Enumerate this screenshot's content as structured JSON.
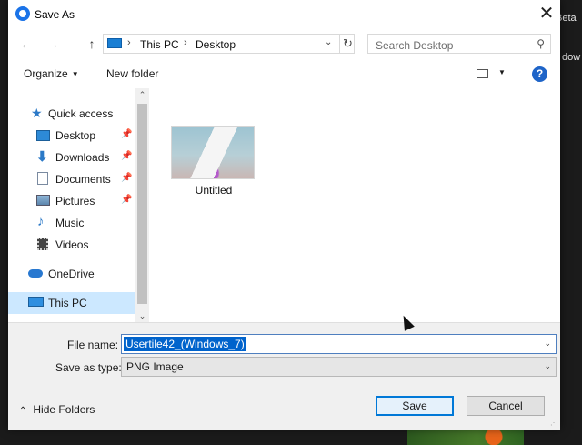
{
  "background": {
    "top_right_text": "Beta",
    "right_text": "dow"
  },
  "window": {
    "title": "Save As"
  },
  "address_bar": {
    "crumbs": [
      "This PC",
      "Desktop"
    ]
  },
  "search": {
    "placeholder": "Search Desktop"
  },
  "toolbar": {
    "organize_label": "Organize",
    "new_folder_label": "New folder"
  },
  "sidebar": {
    "items": [
      {
        "label": "Quick access",
        "icon": "star-icon",
        "pinned": false
      },
      {
        "label": "Desktop",
        "icon": "desktop-folder-icon",
        "pinned": true
      },
      {
        "label": "Downloads",
        "icon": "download-arrow-icon",
        "pinned": true
      },
      {
        "label": "Documents",
        "icon": "documents-icon",
        "pinned": true
      },
      {
        "label": "Pictures",
        "icon": "pictures-icon",
        "pinned": true
      },
      {
        "label": "Music",
        "icon": "music-note-icon",
        "pinned": false
      },
      {
        "label": "Videos",
        "icon": "film-strip-icon",
        "pinned": false
      },
      {
        "label": "OneDrive",
        "icon": "cloud-icon",
        "pinned": false
      },
      {
        "label": "This PC",
        "icon": "computer-icon",
        "pinned": false,
        "selected": true
      }
    ]
  },
  "files": [
    {
      "name": "Untitled"
    }
  ],
  "form": {
    "file_name_label": "File name:",
    "file_name_value": "Usertile42_(Windows_7)",
    "save_type_label": "Save as type:",
    "save_type_value": "PNG Image"
  },
  "footer": {
    "hide_folders_label": "Hide Folders",
    "save_label": "Save",
    "cancel_label": "Cancel"
  },
  "colors": {
    "accent": "#0078d7",
    "selection": "#cce8ff",
    "help": "#1e64c8"
  }
}
